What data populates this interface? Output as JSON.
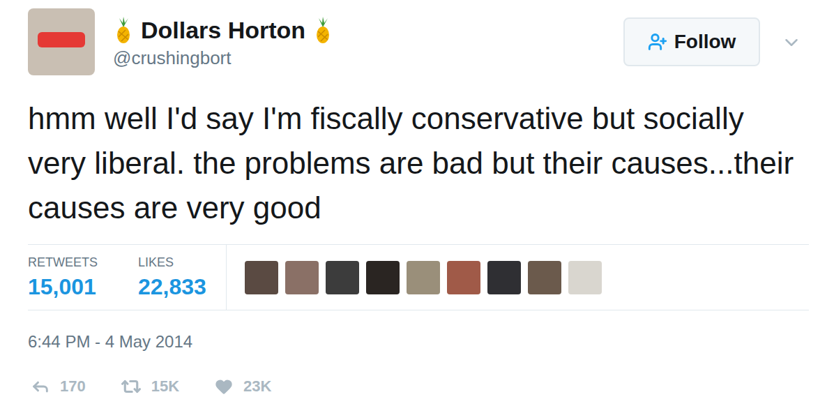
{
  "author": {
    "name": "Dollars Horton",
    "handle": "@crushingbort"
  },
  "follow_button": {
    "label": "Follow"
  },
  "tweet": {
    "text": "hmm well I'd say I'm fiscally conservative but socially very liberal. the problems are bad but their causes...their causes are very good"
  },
  "stats": [
    {
      "label": "RETWEETS",
      "value": "15,001"
    },
    {
      "label": "LIKES",
      "value": "22,833"
    }
  ],
  "timestamp": "6:44 PM - 4 May 2014",
  "actions": [
    {
      "kind": "reply",
      "count": "170",
      "selected": false
    },
    {
      "kind": "retweet",
      "count": "15K",
      "selected": false
    },
    {
      "kind": "like",
      "count": "23K",
      "selected": false
    }
  ]
}
